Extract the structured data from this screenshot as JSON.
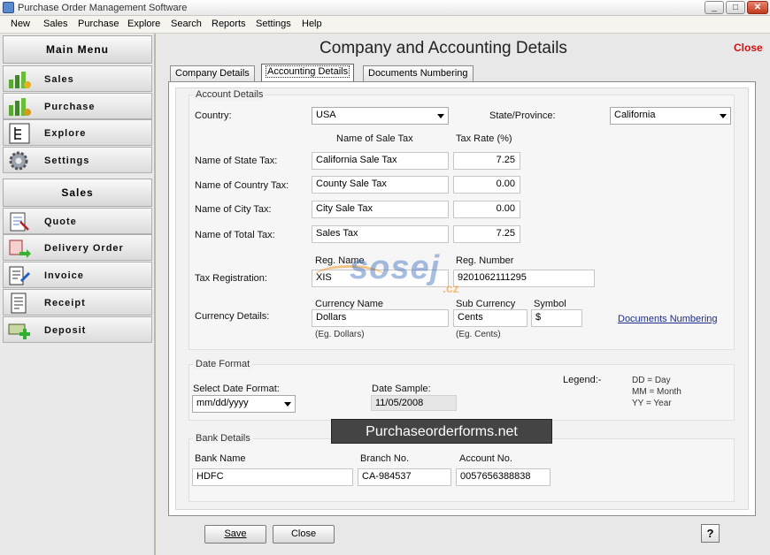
{
  "window": {
    "title": "Purchase Order Management Software",
    "minimize": "_",
    "maximize": "□",
    "close": "✕"
  },
  "menu": [
    "New",
    "Sales",
    "Purchase",
    "Explore",
    "Search",
    "Reports",
    "Settings",
    "Help"
  ],
  "sidebar": {
    "main_menu_title": "Main Menu",
    "main_items": [
      {
        "label": "Sales",
        "icon": "sales-chart-icon"
      },
      {
        "label": "Purchase",
        "icon": "purchase-chart-icon"
      },
      {
        "label": "Explore",
        "icon": "explore-tree-icon"
      },
      {
        "label": "Settings",
        "icon": "gear-icon"
      }
    ],
    "sales_title": "Sales",
    "sales_items": [
      {
        "label": "Quote",
        "icon": "quote-icon"
      },
      {
        "label": "Delivery Order",
        "icon": "delivery-order-icon"
      },
      {
        "label": "Invoice",
        "icon": "invoice-icon"
      },
      {
        "label": "Receipt",
        "icon": "receipt-icon"
      },
      {
        "label": "Deposit",
        "icon": "deposit-icon"
      }
    ]
  },
  "page": {
    "title": "Company and Accounting Details",
    "close_label": "Close"
  },
  "tabs": [
    "Company Details",
    "Accounting Details",
    "Documents Numbering"
  ],
  "account": {
    "group_label": "Account Details",
    "country_label": "Country:",
    "country_value": "USA",
    "state_label": "State/Province:",
    "state_value": "California",
    "col_name_header": "Name of Sale Tax",
    "col_rate_header": "Tax Rate (%)",
    "taxes": [
      {
        "label": "Name of State Tax:",
        "name": "California Sale Tax",
        "rate": "7.25"
      },
      {
        "label": "Name of Country Tax:",
        "name": "County Sale Tax",
        "rate": "0.00"
      },
      {
        "label": "Name of City Tax:",
        "name": "City Sale Tax",
        "rate": "0.00"
      },
      {
        "label": "Name of Total Tax:",
        "name": "Sales Tax",
        "rate": "7.25"
      }
    ],
    "reg_label": "Tax Registration:",
    "reg_name_header": "Reg. Name",
    "reg_name_value": "XIS",
    "reg_number_header": "Reg. Number",
    "reg_number_value": "9201062111295",
    "currency_label": "Currency Details:",
    "currency_name_header": "Currency Name",
    "currency_name_value": "Dollars",
    "currency_name_hint": "(Eg. Dollars)",
    "sub_currency_header": "Sub Currency",
    "sub_currency_value": "Cents",
    "sub_currency_hint": "(Eg. Cents)",
    "symbol_header": "Symbol",
    "symbol_value": "$",
    "documents_link": "Documents Numbering"
  },
  "date_format": {
    "group_label": "Date Format",
    "select_label": "Select Date Format:",
    "select_value": "mm/dd/yyyy",
    "sample_label": "Date Sample:",
    "sample_value": "11/05/2008",
    "legend_label": "Legend:-",
    "legend_lines": [
      "DD = Day",
      "MM = Month",
      "YY = Year"
    ]
  },
  "watermark": {
    "banner": "Purchaseorderforms.net",
    "site": "sosej",
    "tld": ".cz"
  },
  "bank": {
    "group_label": "Bank Details",
    "bank_name_header": "Bank Name",
    "bank_name_value": "HDFC",
    "branch_header": "Branch No.",
    "branch_value": "CA-984537",
    "account_header": "Account No.",
    "account_value": "0057656388838"
  },
  "buttons": {
    "save": "Save",
    "close": "Close",
    "help": "?"
  }
}
